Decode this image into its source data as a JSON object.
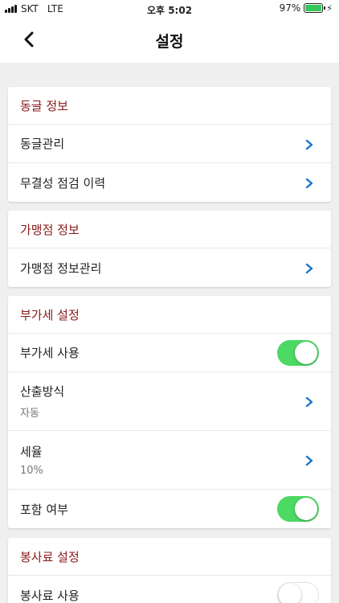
{
  "status_bar": {
    "carrier": "SKT",
    "network": "LTE",
    "time": "오후 5:02",
    "battery": "97%",
    "battery_level": 0.97
  },
  "nav": {
    "title": "설정",
    "back_icon": "chevron-left-icon"
  },
  "sections": {
    "donggle": {
      "header": "동글 정보",
      "items": [
        "동글관리",
        "무결성 점검 이력"
      ]
    },
    "merchant": {
      "header": "가맹점 정보",
      "items": [
        "가맹점 정보관리"
      ]
    },
    "vat": {
      "header": "부가세 설정",
      "use_label": "부가세 사용",
      "use_on": true,
      "calc_label": "산출방식",
      "calc_value": "자동",
      "rate_label": "세율",
      "rate_value": "10%",
      "include_label": "포함 여부",
      "include_on": true
    },
    "service": {
      "header": "봉사료 설정",
      "use_label": "봉사료 사용",
      "use_on": false
    }
  },
  "colors": {
    "section_header": "#8b1a1a",
    "chevron": "#1a73c9",
    "toggle_on": "#4cd964",
    "battery": "#35c759"
  }
}
